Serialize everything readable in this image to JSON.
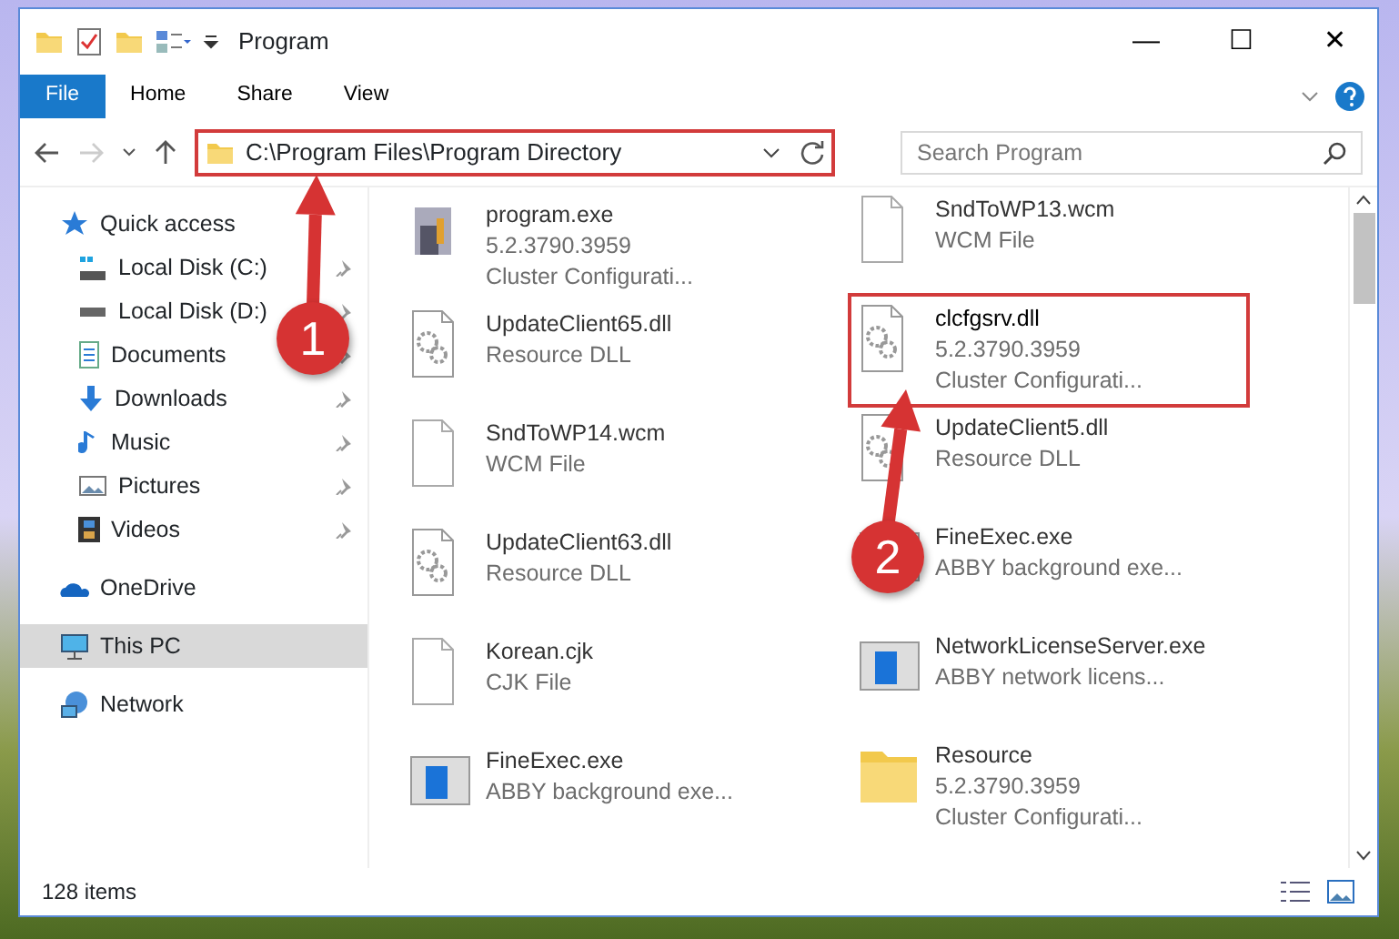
{
  "window": {
    "title": "Program",
    "controls": [
      "—",
      "☐",
      "✕"
    ]
  },
  "ribbon": {
    "tabs": [
      {
        "label": "File",
        "selected": true
      },
      {
        "label": "Home",
        "selected": false
      },
      {
        "label": "Share",
        "selected": false
      },
      {
        "label": "View",
        "selected": false
      }
    ]
  },
  "address_bar": {
    "path": "C:\\Program Files\\Program Directory",
    "highlighted": true
  },
  "search": {
    "placeholder": "Search Program"
  },
  "sidebar": {
    "items": [
      {
        "label": "Quick access",
        "selected": false,
        "children": [
          {
            "label": "Local Disk (C:)",
            "pinned": true
          },
          {
            "label": "Local Disk (D:)",
            "pinned": true
          },
          {
            "label": "Documents",
            "pinned": true
          },
          {
            "label": "Downloads",
            "pinned": true
          },
          {
            "label": "Music",
            "pinned": true
          },
          {
            "label": "Pictures",
            "pinned": true
          },
          {
            "label": "Videos",
            "pinned": true
          }
        ]
      },
      {
        "label": "OneDrive",
        "selected": false
      },
      {
        "label": "This PC",
        "selected": true
      },
      {
        "label": "Network",
        "selected": false
      }
    ]
  },
  "files": [
    {
      "name": "program.exe",
      "lines": [
        "5.2.3790.3959",
        "Cluster Configurati..."
      ],
      "kind": "setup",
      "highlighted": false
    },
    {
      "name": "SndToWP13.wcm",
      "lines": [
        "WCM File"
      ],
      "kind": "blank",
      "highlighted": false
    },
    {
      "name": "UpdateClient65.dll",
      "lines": [
        "Resource DLL"
      ],
      "kind": "gear",
      "highlighted": false
    },
    {
      "name": "clcfgsrv.dll",
      "lines": [
        "5.2.3790.3959",
        "Cluster Configurati..."
      ],
      "kind": "gear",
      "highlighted": true
    },
    {
      "name": "SndToWP14.wcm",
      "lines": [
        "WCM File"
      ],
      "kind": "blank",
      "highlighted": false
    },
    {
      "name": "UpdateClient5.dll",
      "lines": [
        "Resource DLL"
      ],
      "kind": "gear",
      "highlighted": false
    },
    {
      "name": "UpdateClient63.dll",
      "lines": [
        "Resource DLL"
      ],
      "kind": "gear",
      "highlighted": false
    },
    {
      "name": "FineExec.exe",
      "lines": [
        "ABBY background exe..."
      ],
      "kind": "app",
      "highlighted": false
    },
    {
      "name": "Korean.cjk",
      "lines": [
        "CJK File"
      ],
      "kind": "blank",
      "highlighted": false
    },
    {
      "name": "NetworkLicenseServer.exe",
      "lines": [
        "ABBY network licens..."
      ],
      "kind": "app",
      "highlighted": false
    },
    {
      "name": "FineExec.exe",
      "lines": [
        "ABBY background exe..."
      ],
      "kind": "app",
      "highlighted": false
    },
    {
      "name": "Resource",
      "lines": [
        "5.2.3790.3959",
        "Cluster Configurati..."
      ],
      "kind": "folder",
      "highlighted": false
    }
  ],
  "annotations": [
    {
      "label": "1"
    },
    {
      "label": "2"
    }
  ],
  "status_bar": {
    "count": "128 items"
  }
}
